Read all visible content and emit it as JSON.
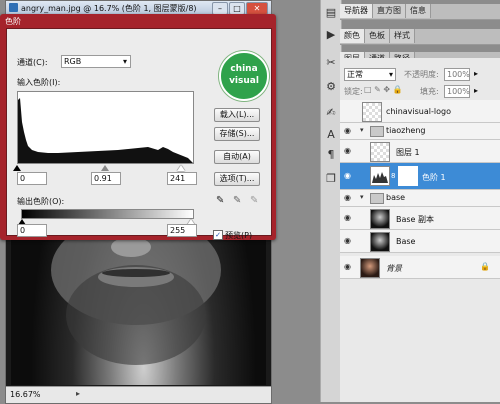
{
  "document": {
    "title": "angry_man.jpg @ 16.7% (色阶 1, 图层蒙版/8)",
    "controls": [
      "–",
      "□",
      "✕"
    ],
    "zoom": "16.67%"
  },
  "levels_dialog": {
    "title": "色阶",
    "channel_label": "通道(C):",
    "channel_value": "RGB",
    "input_levels_label": "输入色阶(I):",
    "input_black": "0",
    "input_gamma": "0.91",
    "input_white": "241",
    "output_levels_label": "输出色阶(O):",
    "output_black": "0",
    "output_white": "255",
    "buttons": {
      "load": "载入(L)...",
      "save": "存储(S)...",
      "auto": "自动(A)",
      "options": "选项(T)..."
    },
    "preview_label": "预览(P)",
    "preview_checked": true,
    "logo": {
      "line1": "china",
      "line2": "visual"
    }
  },
  "panels": {
    "top_tabs": [
      "导航器",
      "直方图",
      "信息"
    ],
    "mid_tabs": [
      "颜色",
      "色板",
      "样式"
    ],
    "layer_tabs": [
      "图层",
      "通道",
      "路径"
    ],
    "blend_mode": "正常",
    "opacity_label": "不透明度:",
    "opacity_value": "100%",
    "lock_label": "锁定:",
    "fill_label": "填充:",
    "fill_value": "100%"
  },
  "layers": [
    {
      "name": "chinavisual-logo"
    },
    {
      "name": "tiaozheng"
    },
    {
      "name": "图层 1"
    },
    {
      "name": "色阶 1"
    },
    {
      "name": "base"
    },
    {
      "name": "Base 副本"
    },
    {
      "name": "Base"
    },
    {
      "name": "背景"
    }
  ]
}
